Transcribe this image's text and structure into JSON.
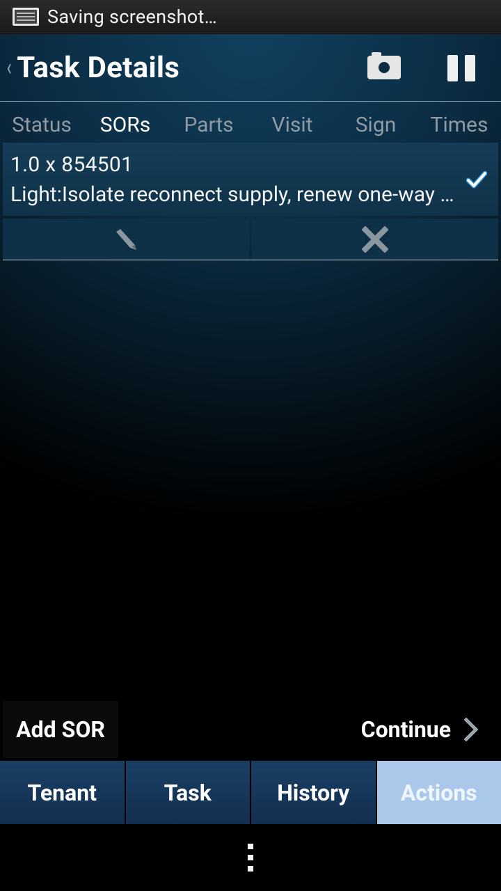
{
  "status_bar": {
    "text": "Saving screenshot…"
  },
  "header": {
    "back_glyph": "‹",
    "title": "Task Details"
  },
  "tabs": [
    {
      "label": "Status",
      "active": false
    },
    {
      "label": "SORs",
      "active": true
    },
    {
      "label": "Parts",
      "active": false
    },
    {
      "label": "Visit",
      "active": false
    },
    {
      "label": "Sign",
      "active": false
    },
    {
      "label": "Times",
      "active": false
    }
  ],
  "sor_item": {
    "line1": "1.0 x 854501",
    "line2": "Light:Isolate reconnect supply, renew one-way switch",
    "checked": true
  },
  "footer": {
    "add_label": "Add SOR",
    "continue_label": "Continue"
  },
  "bottom_nav": [
    {
      "label": "Tenant"
    },
    {
      "label": "Task"
    },
    {
      "label": "History"
    },
    {
      "label": "Actions",
      "selected": true
    }
  ],
  "colors": {
    "accent": "#a9c8ea",
    "nav_bg": "#153658",
    "row_bg": "#123a52",
    "check": "#2f8fd8"
  }
}
